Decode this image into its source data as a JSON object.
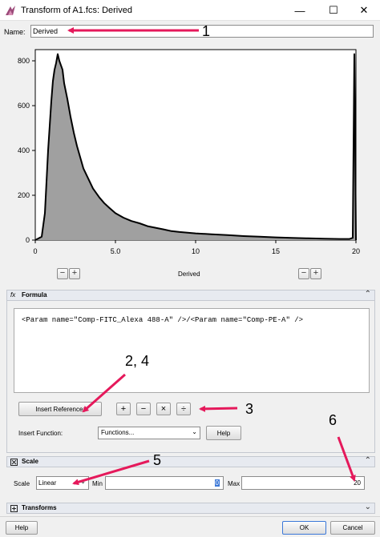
{
  "window": {
    "title": "Transform of A1.fcs: Derived",
    "minimize_glyph": "—",
    "maximize_glyph": "☐",
    "close_glyph": "✕"
  },
  "name_row": {
    "label": "Name:",
    "value": "Derived"
  },
  "chart_data": {
    "type": "area",
    "xlabel": "Derived",
    "xlim": [
      0,
      20
    ],
    "ylim": [
      0,
      850
    ],
    "xticks": [
      0,
      5,
      10,
      15,
      20
    ],
    "xtick_labels": [
      "0",
      "5.0",
      "10",
      "15",
      "20"
    ],
    "yticks": [
      0,
      200,
      400,
      600,
      800
    ],
    "ytick_labels": [
      "0",
      "200",
      "400",
      "600",
      "800"
    ],
    "fill_color": "#a0a0a0",
    "line_color": "#000000",
    "x": [
      0,
      0.4,
      0.6,
      0.8,
      1.0,
      1.1,
      1.2,
      1.3,
      1.4,
      1.5,
      1.6,
      1.7,
      1.8,
      2.0,
      2.2,
      2.4,
      2.6,
      2.8,
      3.0,
      3.2,
      3.4,
      3.6,
      3.8,
      4.0,
      4.3,
      4.6,
      5.0,
      5.5,
      6.0,
      6.5,
      7.0,
      7.5,
      8.0,
      8.5,
      9.0,
      10.0,
      11.0,
      12.0,
      13.0,
      14.0,
      15.0,
      16.0,
      17.0,
      18.0,
      19.0,
      19.6,
      19.8,
      19.9,
      20.0
    ],
    "y": [
      0,
      15,
      120,
      400,
      620,
      710,
      760,
      790,
      830,
      800,
      780,
      760,
      700,
      630,
      550,
      480,
      420,
      370,
      320,
      290,
      260,
      230,
      210,
      190,
      165,
      145,
      120,
      100,
      85,
      75,
      62,
      55,
      48,
      40,
      36,
      30,
      26,
      22,
      18,
      15,
      12,
      10,
      8,
      6,
      5,
      5,
      10,
      830,
      0
    ],
    "minus_buttons": [
      "−",
      "−"
    ],
    "plus_buttons": [
      "+",
      "+"
    ]
  },
  "formula": {
    "header": "Formula",
    "icon_glyph": "fx",
    "chevron": "⌃",
    "expression": "<Param name=\"Comp-FITC_Alexa 488-A\" />/<Param name=\"Comp-PE-A\" />",
    "insert_reference_label": "Insert Reference:",
    "operators": [
      "+",
      "−",
      "×",
      "÷"
    ],
    "insert_function_label": "Insert Function:",
    "functions_value": "Functions...",
    "help_label": "Help"
  },
  "scale": {
    "header": "Scale",
    "chevron": "⌃",
    "scale_label": "Scale",
    "scale_value": "Linear",
    "min_label": "Min",
    "min_value": "0",
    "max_label": "Max",
    "max_value": "20"
  },
  "transforms": {
    "header": "Transforms",
    "chevron": "⌄"
  },
  "footer": {
    "help_label": "Help",
    "ok_label": "OK",
    "cancel_label": "Cancel"
  },
  "callouts": [
    "1",
    "2, 4",
    "3",
    "5",
    "6"
  ],
  "colors": {
    "callout_arrow": "#e5195b",
    "section_header": "#e7eaf0"
  }
}
